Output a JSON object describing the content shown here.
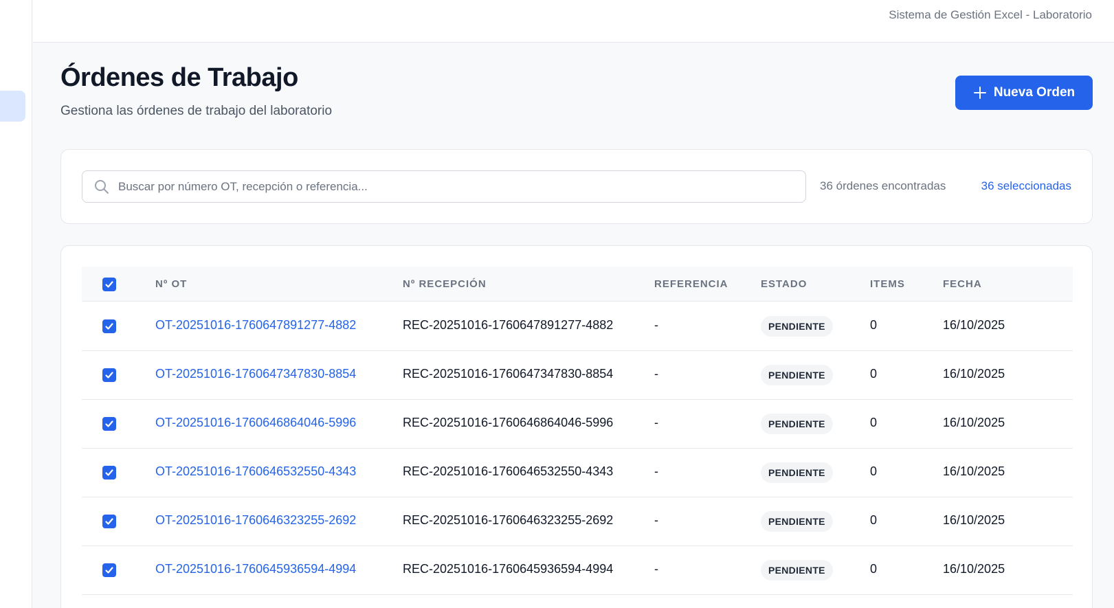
{
  "app": {
    "title": "Sistema de Gestión Excel - Laboratorio"
  },
  "header": {
    "title": "Órdenes de Trabajo",
    "subtitle": "Gestiona las órdenes de trabajo del laboratorio",
    "new_button_label": "Nueva Orden",
    "new_button_icon": "plus-icon"
  },
  "search": {
    "placeholder": "Buscar por número OT, recepción o referencia...",
    "value": "",
    "icon": "search-icon",
    "count_text": "36 órdenes encontradas",
    "selected_text": "36 seleccionadas"
  },
  "table": {
    "select_all_checked": true,
    "columns": [
      "Nº OT",
      "Nº RECEPCIÓN",
      "REFERENCIA",
      "ESTADO",
      "ITEMS",
      "FECHA"
    ],
    "rows": [
      {
        "checked": true,
        "ot": "OT-20251016-1760647891277-4882",
        "recepcion": "REC-20251016-1760647891277-4882",
        "referencia": "-",
        "estado": "PENDIENTE",
        "items": "0",
        "fecha": "16/10/2025"
      },
      {
        "checked": true,
        "ot": "OT-20251016-1760647347830-8854",
        "recepcion": "REC-20251016-1760647347830-8854",
        "referencia": "-",
        "estado": "PENDIENTE",
        "items": "0",
        "fecha": "16/10/2025"
      },
      {
        "checked": true,
        "ot": "OT-20251016-1760646864046-5996",
        "recepcion": "REC-20251016-1760646864046-5996",
        "referencia": "-",
        "estado": "PENDIENTE",
        "items": "0",
        "fecha": "16/10/2025"
      },
      {
        "checked": true,
        "ot": "OT-20251016-1760646532550-4343",
        "recepcion": "REC-20251016-1760646532550-4343",
        "referencia": "-",
        "estado": "PENDIENTE",
        "items": "0",
        "fecha": "16/10/2025"
      },
      {
        "checked": true,
        "ot": "OT-20251016-1760646323255-2692",
        "recepcion": "REC-20251016-1760646323255-2692",
        "referencia": "-",
        "estado": "PENDIENTE",
        "items": "0",
        "fecha": "16/10/2025"
      },
      {
        "checked": true,
        "ot": "OT-20251016-1760645936594-4994",
        "recepcion": "REC-20251016-1760645936594-4994",
        "referencia": "-",
        "estado": "PENDIENTE",
        "items": "0",
        "fecha": "16/10/2025"
      }
    ]
  },
  "colors": {
    "accent": "#2563eb",
    "badge_bg": "#f3f4f6",
    "sidebar_active": "#dbe7fe"
  }
}
